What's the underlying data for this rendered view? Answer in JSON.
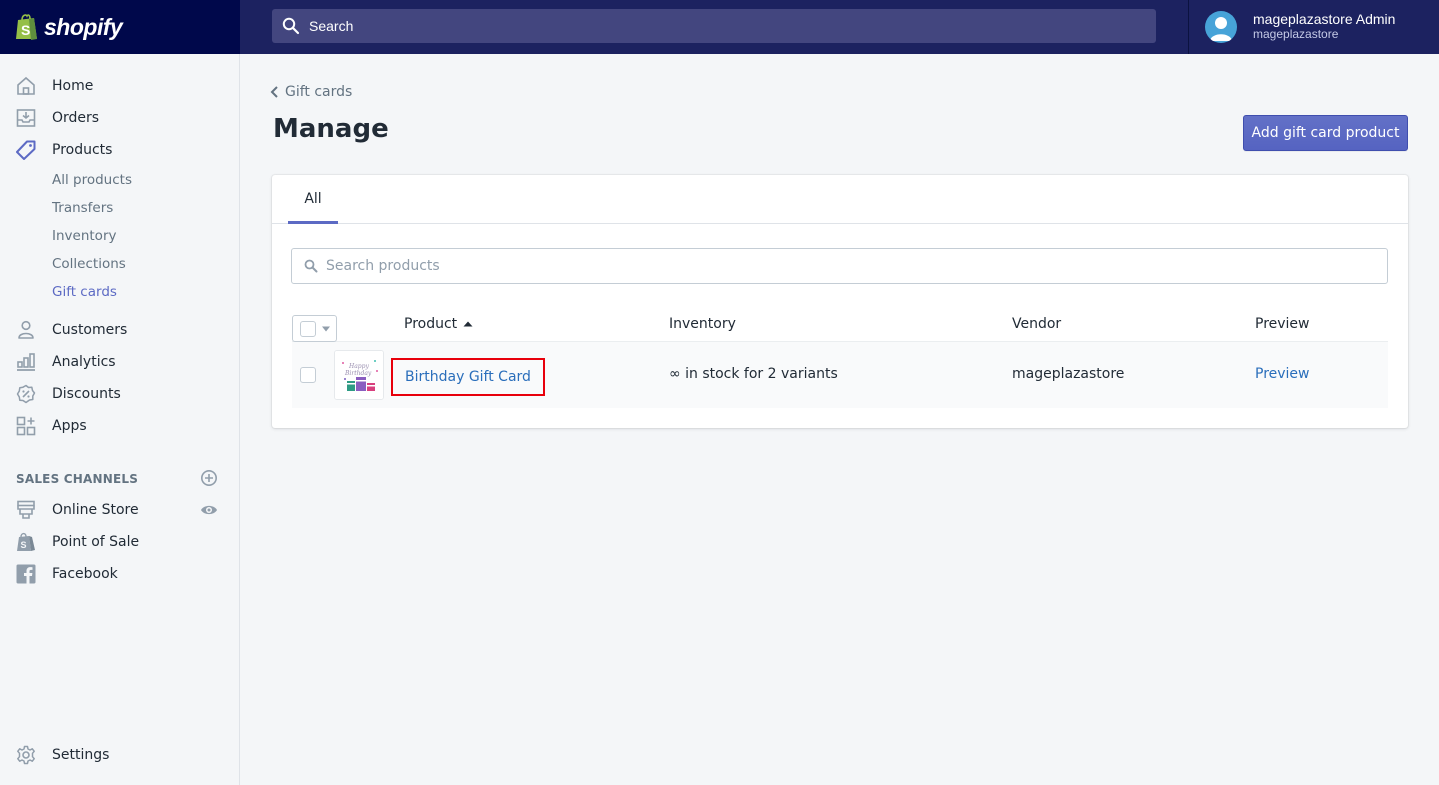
{
  "app": {
    "brand": "shopify"
  },
  "topbar": {
    "search_label": "Search",
    "user_name": "mageplazastore Admin",
    "user_store": "mageplazastore"
  },
  "sidebar": {
    "items": [
      {
        "label": "Home",
        "icon": "home-icon"
      },
      {
        "label": "Orders",
        "icon": "orders-icon"
      },
      {
        "label": "Products",
        "icon": "tag-icon",
        "active": true
      },
      {
        "label": "Customers",
        "icon": "customer-icon"
      },
      {
        "label": "Analytics",
        "icon": "analytics-icon"
      },
      {
        "label": "Discounts",
        "icon": "discount-icon"
      },
      {
        "label": "Apps",
        "icon": "apps-icon"
      }
    ],
    "product_subitems": [
      {
        "label": "All products"
      },
      {
        "label": "Transfers"
      },
      {
        "label": "Inventory"
      },
      {
        "label": "Collections"
      },
      {
        "label": "Gift cards",
        "active": true
      }
    ],
    "sales_channels_heading": "SALES CHANNELS",
    "channels": [
      {
        "label": "Online Store",
        "icon": "store-icon"
      },
      {
        "label": "Point of Sale",
        "icon": "pos-bag-icon"
      },
      {
        "label": "Facebook",
        "icon": "facebook-icon"
      }
    ],
    "settings_label": "Settings"
  },
  "main": {
    "breadcrumb": "Gift cards",
    "title": "Manage",
    "primary_action": "Add gift card product",
    "tabs": [
      {
        "label": "All",
        "selected": true
      }
    ],
    "search_placeholder": "Search products",
    "table": {
      "columns": [
        "Product",
        "Inventory",
        "Vendor",
        "Preview"
      ],
      "sort_column": "Product",
      "sort_direction": "ascending",
      "rows": [
        {
          "product": "Birthday Gift Card",
          "inventory": "∞ in stock for 2 variants",
          "vendor": "mageplazastore",
          "preview": "Preview",
          "highlighted": true
        }
      ]
    }
  },
  "colors": {
    "accent": "#5c6ac4",
    "topbar": "#1c2260",
    "logo_bg": "#00084b",
    "link": "#2a6ebb",
    "highlight_border": "#e8000b"
  }
}
